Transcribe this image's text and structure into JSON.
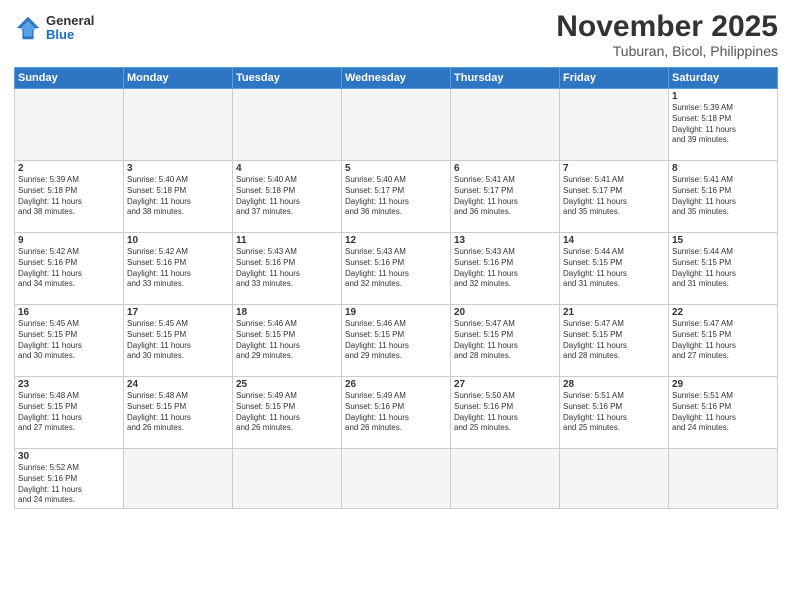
{
  "header": {
    "logo": {
      "general": "General",
      "blue": "Blue"
    },
    "title": "November 2025",
    "subtitle": "Tuburan, Bicol, Philippines"
  },
  "weekdays": [
    "Sunday",
    "Monday",
    "Tuesday",
    "Wednesday",
    "Thursday",
    "Friday",
    "Saturday"
  ],
  "weeks": [
    [
      {
        "day": "",
        "info": ""
      },
      {
        "day": "",
        "info": ""
      },
      {
        "day": "",
        "info": ""
      },
      {
        "day": "",
        "info": ""
      },
      {
        "day": "",
        "info": ""
      },
      {
        "day": "",
        "info": ""
      },
      {
        "day": "1",
        "info": "Sunrise: 5:39 AM\nSunset: 5:18 PM\nDaylight: 11 hours\nand 39 minutes."
      }
    ],
    [
      {
        "day": "2",
        "info": "Sunrise: 5:39 AM\nSunset: 5:18 PM\nDaylight: 11 hours\nand 38 minutes."
      },
      {
        "day": "3",
        "info": "Sunrise: 5:40 AM\nSunset: 5:18 PM\nDaylight: 11 hours\nand 38 minutes."
      },
      {
        "day": "4",
        "info": "Sunrise: 5:40 AM\nSunset: 5:18 PM\nDaylight: 11 hours\nand 37 minutes."
      },
      {
        "day": "5",
        "info": "Sunrise: 5:40 AM\nSunset: 5:17 PM\nDaylight: 11 hours\nand 36 minutes."
      },
      {
        "day": "6",
        "info": "Sunrise: 5:41 AM\nSunset: 5:17 PM\nDaylight: 11 hours\nand 36 minutes."
      },
      {
        "day": "7",
        "info": "Sunrise: 5:41 AM\nSunset: 5:17 PM\nDaylight: 11 hours\nand 35 minutes."
      },
      {
        "day": "8",
        "info": "Sunrise: 5:41 AM\nSunset: 5:16 PM\nDaylight: 11 hours\nand 35 minutes."
      }
    ],
    [
      {
        "day": "9",
        "info": "Sunrise: 5:42 AM\nSunset: 5:16 PM\nDaylight: 11 hours\nand 34 minutes."
      },
      {
        "day": "10",
        "info": "Sunrise: 5:42 AM\nSunset: 5:16 PM\nDaylight: 11 hours\nand 33 minutes."
      },
      {
        "day": "11",
        "info": "Sunrise: 5:43 AM\nSunset: 5:16 PM\nDaylight: 11 hours\nand 33 minutes."
      },
      {
        "day": "12",
        "info": "Sunrise: 5:43 AM\nSunset: 5:16 PM\nDaylight: 11 hours\nand 32 minutes."
      },
      {
        "day": "13",
        "info": "Sunrise: 5:43 AM\nSunset: 5:16 PM\nDaylight: 11 hours\nand 32 minutes."
      },
      {
        "day": "14",
        "info": "Sunrise: 5:44 AM\nSunset: 5:15 PM\nDaylight: 11 hours\nand 31 minutes."
      },
      {
        "day": "15",
        "info": "Sunrise: 5:44 AM\nSunset: 5:15 PM\nDaylight: 11 hours\nand 31 minutes."
      }
    ],
    [
      {
        "day": "16",
        "info": "Sunrise: 5:45 AM\nSunset: 5:15 PM\nDaylight: 11 hours\nand 30 minutes."
      },
      {
        "day": "17",
        "info": "Sunrise: 5:45 AM\nSunset: 5:15 PM\nDaylight: 11 hours\nand 30 minutes."
      },
      {
        "day": "18",
        "info": "Sunrise: 5:46 AM\nSunset: 5:15 PM\nDaylight: 11 hours\nand 29 minutes."
      },
      {
        "day": "19",
        "info": "Sunrise: 5:46 AM\nSunset: 5:15 PM\nDaylight: 11 hours\nand 29 minutes."
      },
      {
        "day": "20",
        "info": "Sunrise: 5:47 AM\nSunset: 5:15 PM\nDaylight: 11 hours\nand 28 minutes."
      },
      {
        "day": "21",
        "info": "Sunrise: 5:47 AM\nSunset: 5:15 PM\nDaylight: 11 hours\nand 28 minutes."
      },
      {
        "day": "22",
        "info": "Sunrise: 5:47 AM\nSunset: 5:15 PM\nDaylight: 11 hours\nand 27 minutes."
      }
    ],
    [
      {
        "day": "23",
        "info": "Sunrise: 5:48 AM\nSunset: 5:15 PM\nDaylight: 11 hours\nand 27 minutes."
      },
      {
        "day": "24",
        "info": "Sunrise: 5:48 AM\nSunset: 5:15 PM\nDaylight: 11 hours\nand 26 minutes."
      },
      {
        "day": "25",
        "info": "Sunrise: 5:49 AM\nSunset: 5:15 PM\nDaylight: 11 hours\nand 26 minutes."
      },
      {
        "day": "26",
        "info": "Sunrise: 5:49 AM\nSunset: 5:16 PM\nDaylight: 11 hours\nand 26 minutes."
      },
      {
        "day": "27",
        "info": "Sunrise: 5:50 AM\nSunset: 5:16 PM\nDaylight: 11 hours\nand 25 minutes."
      },
      {
        "day": "28",
        "info": "Sunrise: 5:51 AM\nSunset: 5:16 PM\nDaylight: 11 hours\nand 25 minutes."
      },
      {
        "day": "29",
        "info": "Sunrise: 5:51 AM\nSunset: 5:16 PM\nDaylight: 11 hours\nand 24 minutes."
      }
    ],
    [
      {
        "day": "30",
        "info": "Sunrise: 5:52 AM\nSunset: 5:16 PM\nDaylight: 11 hours\nand 24 minutes."
      },
      {
        "day": "",
        "info": ""
      },
      {
        "day": "",
        "info": ""
      },
      {
        "day": "",
        "info": ""
      },
      {
        "day": "",
        "info": ""
      },
      {
        "day": "",
        "info": ""
      },
      {
        "day": "",
        "info": ""
      }
    ]
  ]
}
